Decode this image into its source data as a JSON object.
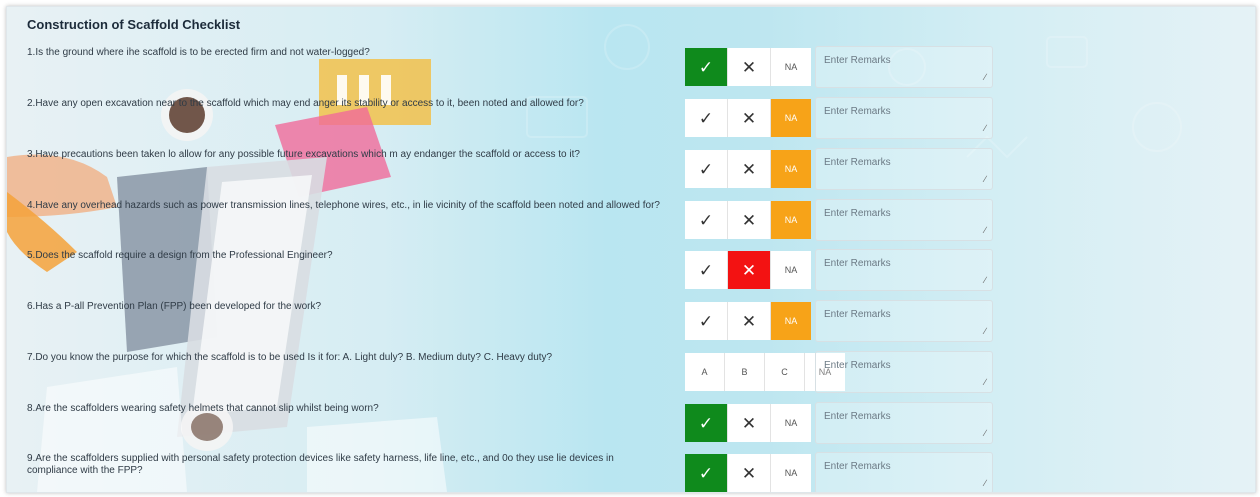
{
  "title": "Construction of Scaffold Checklist",
  "remarks_placeholder": "Enter Remarks",
  "icons": {
    "yes": "check-icon",
    "no": "cross-icon",
    "resize": "resize-grip-icon"
  },
  "colors": {
    "yes": "#0f8a1c",
    "no": "#f31212",
    "na": "#f7a318"
  },
  "questions": [
    {
      "text": "1.Is the ground where ihe scaffold is to be erected firm and not water-logged?",
      "type": "ync",
      "selected": "yes"
    },
    {
      "text": "2.Have any open excavation near to the scaffold which may end anger its stability or access to it, been noted and allowed for?",
      "type": "ync",
      "selected": "na"
    },
    {
      "text": "3.Have precautions been taken lo allow for any possible future excavations which m ay endanger the scaffold or access to it?",
      "type": "ync",
      "selected": "na"
    },
    {
      "text": "4.Have any overhead hazards such as power transmission lines, telephone wires, etc., in lie vicinity of the scaffold been noted and allowed for?",
      "type": "ync",
      "selected": "na"
    },
    {
      "text": "5.Does the scaffold require a design from the Professional Engineer?",
      "type": "ync",
      "selected": "no"
    },
    {
      "text": "6.Has a P-all Prevention Plan (FPP) been developed for the work?",
      "type": "ync",
      "selected": "na"
    },
    {
      "text": "7.Do you know the purpose for which the scaffold is to be used Is it for: A. Light duly? B. Medium duty? C. Heavy duty?",
      "type": "abc",
      "selected": "",
      "options": [
        "A",
        "B",
        "C",
        "NA"
      ]
    },
    {
      "text": "8.Are the scaffolders wearing safety helmets that cannot slip whilst being worn?",
      "type": "ync",
      "selected": "yes"
    },
    {
      "text": "9.Are the scaffolders supplied with personal safety protection devices like safety harness, life line, etc., and 0o they use lie devices in compliance with the FPP?",
      "type": "ync",
      "selected": "yes"
    }
  ],
  "na_label": "NA"
}
